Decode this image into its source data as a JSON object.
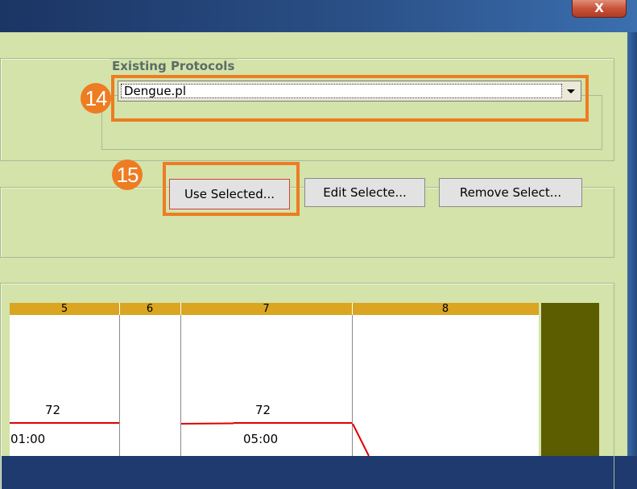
{
  "window": {
    "close_label": "X"
  },
  "protocols": {
    "legend": "Existing Protocols",
    "selected": "Dengue.pl"
  },
  "callouts": {
    "step14": "14",
    "step15": "15"
  },
  "buttons": {
    "use_selected": "Use Selected...",
    "edit_selected": "Edit Selecte...",
    "remove_selected": "Remove Select..."
  },
  "grid": {
    "columns": [
      "5",
      "6",
      "7",
      "8"
    ],
    "cells": {
      "col5_value": "72",
      "col5_time": "01:00",
      "col7_value": "72",
      "col7_time": "05:00"
    }
  },
  "colors": {
    "highlight": "#ee7c22",
    "panel": "#d3e3a9",
    "grid_header": "#daa520",
    "trend_line": "#e00000",
    "olive_block": "#5c5c00"
  }
}
